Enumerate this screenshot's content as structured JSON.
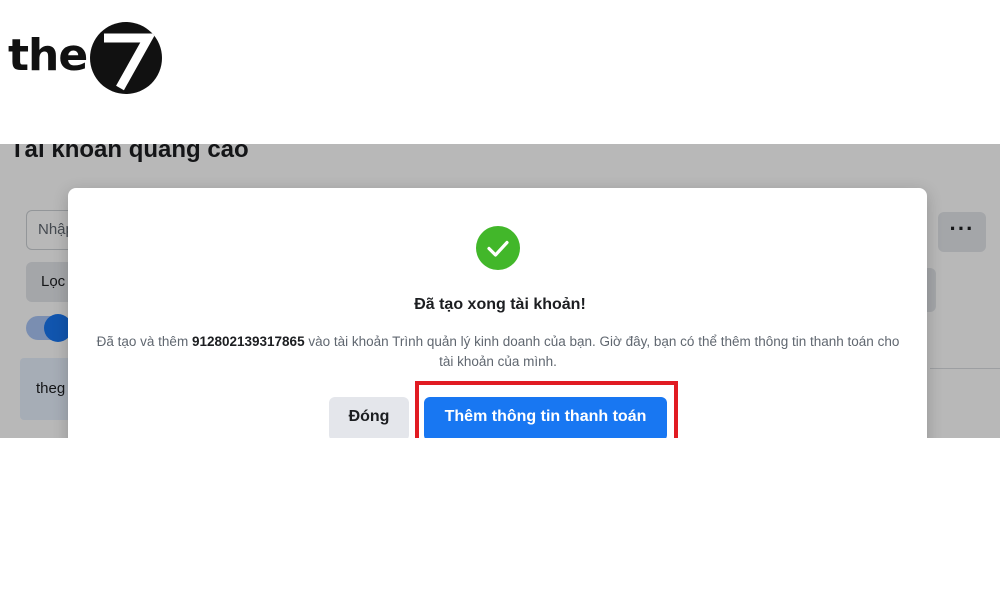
{
  "logo": {
    "text": "the",
    "mark": "7"
  },
  "background": {
    "page_title": "Tài khoản quảng cáo",
    "search_placeholder": "Nhập",
    "filter_label": "Lọc",
    "more_label": "···",
    "row_text": "theg"
  },
  "modal": {
    "icon": "check-circle-icon",
    "title": "Đã tạo xong tài khoản!",
    "message_before": "Đã tạo và thêm ",
    "account_id": "912802139317865",
    "message_after": " vào tài khoản Trình quản lý kinh doanh của bạn. Giờ đây, bạn có thể thêm thông tin thanh toán cho tài khoản của mình.",
    "close_label": "Đóng",
    "add_payment_label": "Thêm thông tin thanh toán"
  },
  "colors": {
    "accent": "#1877f2",
    "success": "#42b72a",
    "highlight": "#e11b22"
  }
}
